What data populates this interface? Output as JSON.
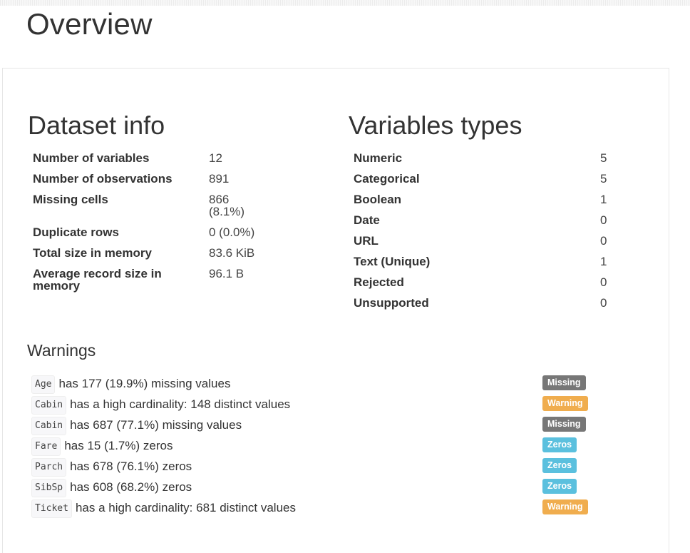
{
  "page_title": "Overview",
  "dataset_info": {
    "heading": "Dataset info",
    "rows": [
      {
        "label": "Number of variables",
        "value": "12",
        "value2": ""
      },
      {
        "label": "Number of observations",
        "value": "891",
        "value2": ""
      },
      {
        "label": "Missing cells",
        "value": "866",
        "value2": "(8.1%)"
      },
      {
        "label": "Duplicate rows",
        "value": "0 (0.0%)",
        "value2": ""
      },
      {
        "label": "Total size in memory",
        "value": "83.6 KiB",
        "value2": ""
      },
      {
        "label": "Average record size in",
        "label2": "memory",
        "value": "96.1 B",
        "value2": ""
      }
    ]
  },
  "variable_types": {
    "heading": "Variables types",
    "rows": [
      {
        "label": "Numeric",
        "value": "5"
      },
      {
        "label": "Categorical",
        "value": "5"
      },
      {
        "label": "Boolean",
        "value": "1"
      },
      {
        "label": "Date",
        "value": "0"
      },
      {
        "label": "URL",
        "value": "0"
      },
      {
        "label": "Text (Unique)",
        "value": "1"
      },
      {
        "label": "Rejected",
        "value": "0"
      },
      {
        "label": "Unsupported",
        "value": "0"
      }
    ]
  },
  "warnings": {
    "heading": "Warnings",
    "items": [
      {
        "variable": "Age",
        "text": "has 177 (19.9%) missing values",
        "badge": "Missing",
        "badge_type": "missing"
      },
      {
        "variable": "Cabin",
        "text": "has a high cardinality: 148 distinct values",
        "badge": "Warning",
        "badge_type": "warning"
      },
      {
        "variable": "Cabin",
        "text": "has 687 (77.1%) missing values",
        "badge": "Missing",
        "badge_type": "missing"
      },
      {
        "variable": "Fare",
        "text": "has 15 (1.7%) zeros",
        "badge": "Zeros",
        "badge_type": "zeros"
      },
      {
        "variable": "Parch",
        "text": "has 678 (76.1%) zeros",
        "badge": "Zeros",
        "badge_type": "zeros"
      },
      {
        "variable": "SibSp",
        "text": "has 608 (68.2%) zeros",
        "badge": "Zeros",
        "badge_type": "zeros"
      },
      {
        "variable": "Ticket",
        "text": "has a high cardinality: 681 distinct values",
        "badge": "Warning",
        "badge_type": "warning"
      }
    ]
  },
  "colors": {
    "badge_missing": "#777777",
    "badge_warning": "#f0ad4e",
    "badge_zeros": "#5bc0de"
  }
}
